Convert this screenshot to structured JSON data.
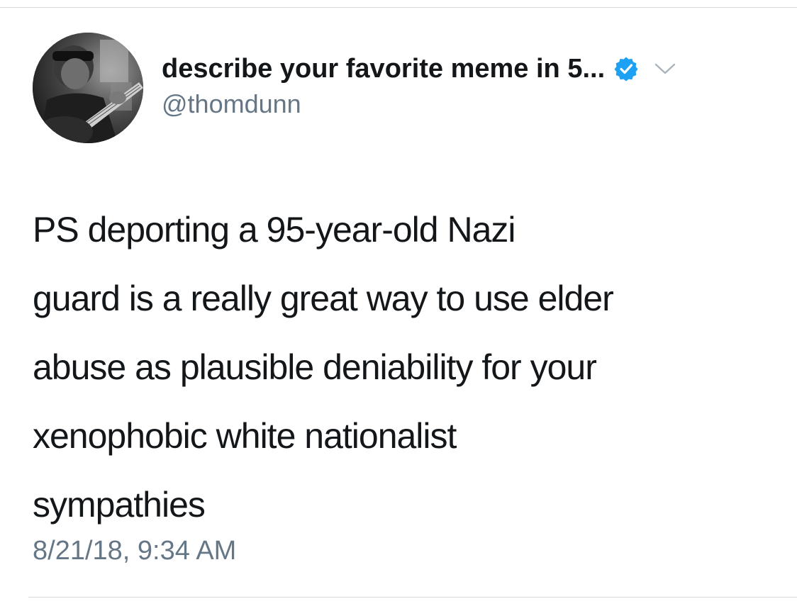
{
  "tweet": {
    "author": {
      "display_name": "describe your favorite meme in 5...",
      "handle": "@thomdunn",
      "verified": true
    },
    "text_lines": [
      "PS deporting a 95-year-old Nazi",
      "guard is a really great way to use elder",
      "abuse as plausible deniability for your",
      "xenophobic white nationalist",
      "sympathies"
    ],
    "timestamp": "8/21/18, 9:34 AM"
  },
  "icons": {
    "verified": "verified-badge-icon",
    "menu": "chevron-down-icon"
  },
  "colors": {
    "text_primary": "#14171a",
    "text_secondary": "#657786",
    "verified_blue": "#1da1f2",
    "divider": "#d6d9dc"
  }
}
